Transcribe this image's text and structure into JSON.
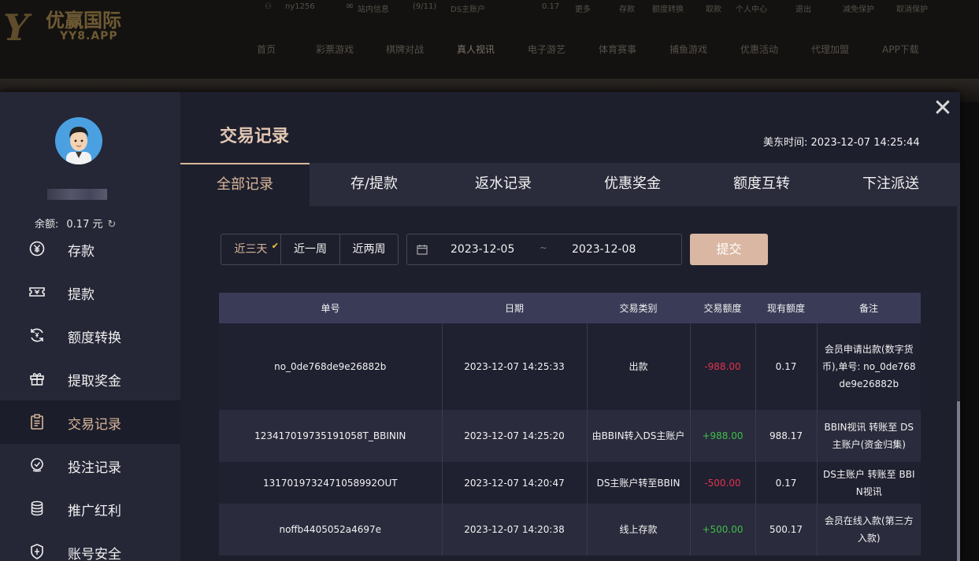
{
  "site": {
    "logo_cn": "优赢国际",
    "logo_en": "YY8.APP",
    "topbar": [
      "ny1256",
      "站内信息",
      "(9/11)",
      "DS主账户",
      "0.17",
      "更多",
      "存款",
      "额度转换",
      "取款",
      "个人中心",
      "退出",
      "减免保护",
      "取消保护"
    ],
    "nav": [
      "首页",
      "彩票游戏",
      "棋牌对战",
      "真人视讯",
      "电子游艺",
      "体育赛事",
      "捕鱼游戏",
      "优惠活动",
      "代理加盟",
      "APP下载"
    ],
    "nav_active": "真人视讯"
  },
  "modal": {
    "close_symbol": "✕"
  },
  "sidebar": {
    "balance_label": "余额:",
    "balance_value": "0.17 元",
    "refresh_symbol": "↻",
    "items": [
      {
        "label": "存款",
        "icon": "yen-coin-icon"
      },
      {
        "label": "提款",
        "icon": "cash-ticket-icon"
      },
      {
        "label": "额度转换",
        "icon": "transfer-icon"
      },
      {
        "label": "提取奖金",
        "icon": "gift-icon"
      },
      {
        "label": "交易记录",
        "icon": "clipboard-icon",
        "active": true
      },
      {
        "label": "投注记录",
        "icon": "bet-record-icon"
      },
      {
        "label": "推广红利",
        "icon": "coin-stack-icon"
      },
      {
        "label": "账号安全",
        "icon": "shield-icon"
      }
    ]
  },
  "content": {
    "title": "交易记录",
    "time_label": "美东时间:",
    "time_value": "2023-12-07 14:25:44",
    "tabs": [
      "全部记录",
      "存/提款",
      "返水记录",
      "优惠奖金",
      "额度互转",
      "下注派送"
    ],
    "active_tab": 0,
    "ranges": [
      "近三天",
      "近一周",
      "近两周"
    ],
    "date_start": "2023-12-05",
    "date_sep": "~",
    "date_end": "2023-12-08",
    "submit_label": "提交"
  },
  "table": {
    "headers": [
      "单号",
      "日期",
      "交易类别",
      "交易额度",
      "现有额度",
      "备注"
    ],
    "rows": [
      {
        "id": "no_0de768de9e26882b",
        "date": "2023-12-07 14:25:33",
        "type": "出款",
        "amount": "-988.00",
        "balance": "0.17",
        "note": "会员申请出款(数字货币),单号: no_0de768de9e26882b"
      },
      {
        "id": "123417019735191058T_BBININ",
        "date": "2023-12-07 14:25:20",
        "type": "由BBIN转入DS主账户",
        "amount": "+988.00",
        "balance": "988.17",
        "note": "BBIN视讯 转账至 DS主账户(资金归集)"
      },
      {
        "id": "1317019732471058992OUT",
        "date": "2023-12-07 14:20:47",
        "type": "DS主账户转至BBIN",
        "amount": "-500.00",
        "balance": "0.17",
        "note": "DS主账户 转账至 BBIN视讯"
      },
      {
        "id": "noffb4405052a4697e",
        "date": "2023-12-07 14:20:38",
        "type": "线上存款",
        "amount": "+500.00",
        "balance": "500.17",
        "note": "会员在线入款(第三方入款)"
      }
    ]
  },
  "colors": {
    "accent": "#d9b79a",
    "negative": "#e0334d",
    "positive": "#3fbf4a",
    "sidebar_bg": "#252636",
    "modal_bg": "#1e1f2d",
    "table_header_bg": "#3a3c57"
  }
}
